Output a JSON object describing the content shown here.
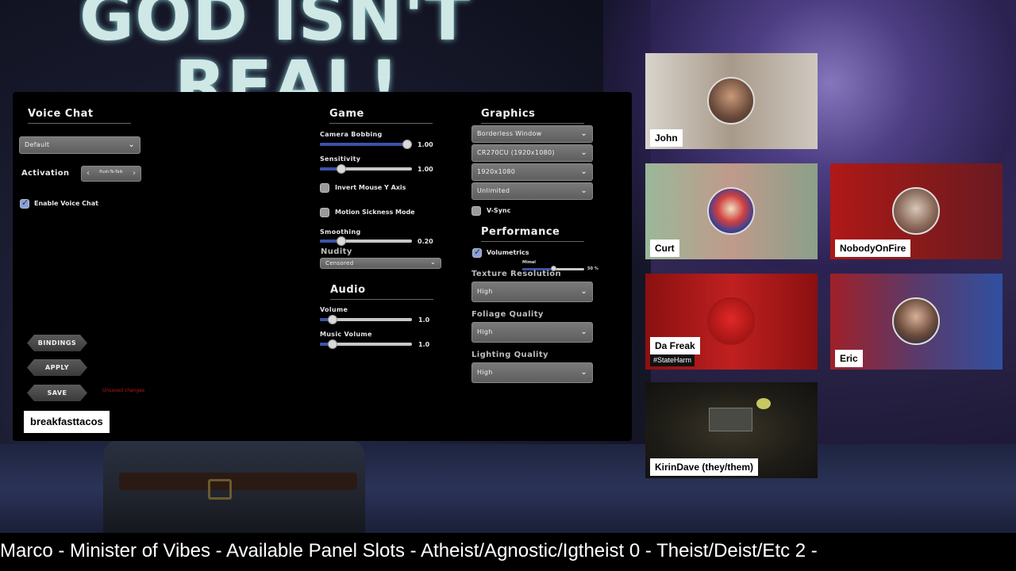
{
  "background": {
    "title_line1": "GOD ISN'T",
    "title_line2": "REAL!"
  },
  "settings": {
    "voice_chat": {
      "title": "Voice Chat",
      "device": "Default",
      "activation_label": "Activation",
      "activation_value": "Push-To-Talk",
      "enable_label": "Enable Voice Chat",
      "enabled": true
    },
    "game": {
      "title": "Game",
      "camera_bobbing_label": "Camera Bobbing",
      "camera_bobbing_value": "1.00",
      "camera_bobbing_level": 1.0,
      "sensitivity_label": "Sensitivity",
      "sensitivity_value": "1.00",
      "sensitivity_level": 0.2,
      "invert_label": "Invert Mouse Y Axis",
      "motion_sickness_label": "Motion Sickness Mode",
      "smoothing_label": "Smoothing",
      "smoothing_value": "0.20",
      "smoothing_level": 0.2,
      "nudity_label": "Nudity",
      "nudity_value": "Censored"
    },
    "audio": {
      "title": "Audio",
      "volume_label": "Volume",
      "volume_value": "1.0",
      "volume_level": 0.1,
      "music_label": "Music Volume",
      "music_value": "1.0",
      "music_level": 0.1
    },
    "graphics": {
      "title": "Graphics",
      "window_mode": "Borderless Window",
      "monitor": "CR270CU (1920x1080)",
      "resolution": "1920x1080",
      "fps": "Unlimited",
      "vsync_label": "V-Sync"
    },
    "performance": {
      "title": "Performance",
      "volumetrics_label": "Volumetrics",
      "volumetrics_sub": "Mimal",
      "volumetrics_value": "50 %",
      "volumetrics_level": 0.5,
      "texture_label": "Texture Resolution",
      "texture_value": "High",
      "foliage_label": "Foliage Quality",
      "foliage_value": "High",
      "lighting_label": "Lighting Quality",
      "lighting_value": "High"
    },
    "buttons": {
      "bindings": "BINDINGS",
      "apply": "APPLY",
      "save": "SAVE",
      "unsaved_note": "Unsaved changes"
    }
  },
  "username": "breakfasttacos",
  "participants": [
    {
      "name": "John"
    },
    {
      "name": "Curt"
    },
    {
      "name": "NobodyOnFire"
    },
    {
      "name": "Da Freak",
      "tag": "#StateHarm"
    },
    {
      "name": "Eric"
    },
    {
      "name": "KirinDave (they/them)"
    }
  ],
  "ticker": "Marco - Minister of Vibes - Available Panel Slots - Atheist/Agnostic/Igtheist 0 - Theist/Deist/Etc 2 -",
  "colors": {
    "accent_blue": "#3b53a8",
    "panel_bg": "#000000",
    "unsaved_red": "#c01818"
  }
}
